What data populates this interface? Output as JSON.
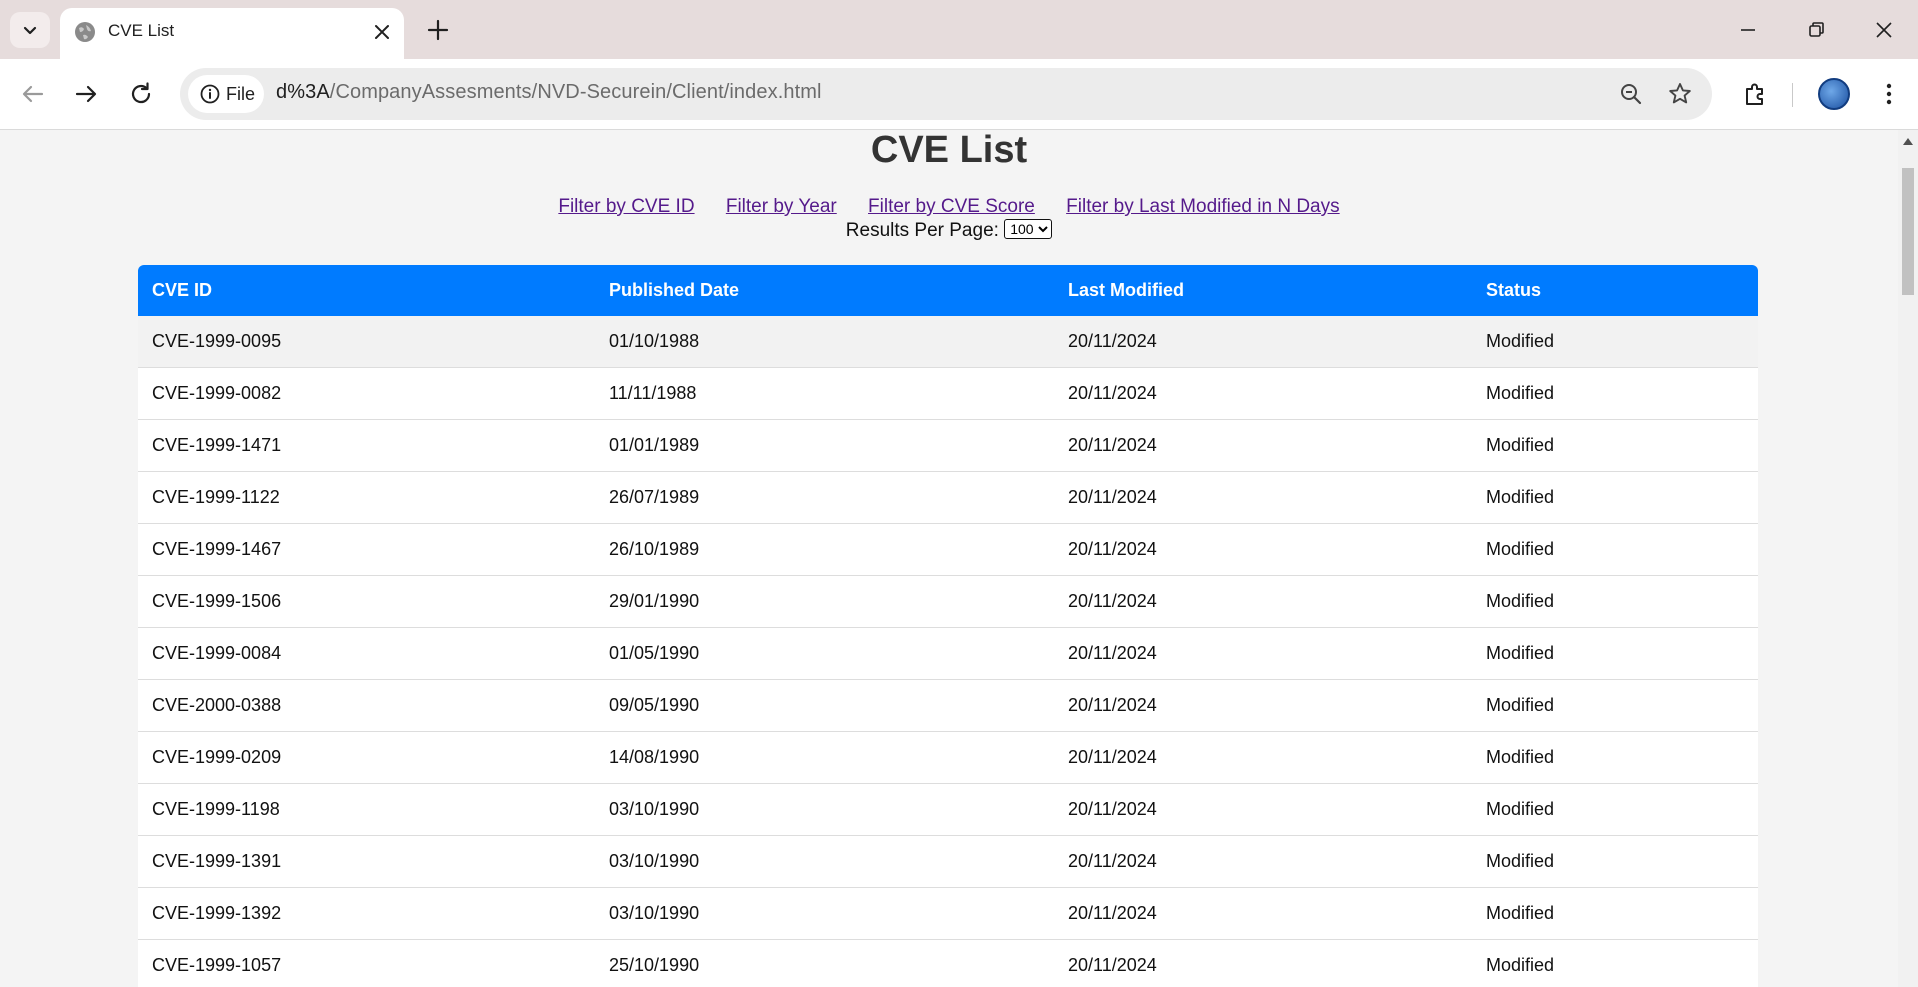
{
  "browser": {
    "tab_title": "CVE List",
    "site_chip": "File",
    "url_host": "d%3A",
    "url_path": "/CompanyAssesments/NVD-Securein/Client/index.html"
  },
  "page": {
    "title": "CVE List",
    "filters": [
      "Filter by CVE ID",
      "Filter by Year",
      "Filter by CVE Score",
      "Filter by Last Modified in N Days"
    ],
    "results_per_page_label": "Results Per Page:",
    "results_per_page_value": "100"
  },
  "table": {
    "headers": [
      "CVE ID",
      "Published Date",
      "Last Modified",
      "Status"
    ],
    "rows": [
      [
        "CVE-1999-0095",
        "01/10/1988",
        "20/11/2024",
        "Modified"
      ],
      [
        "CVE-1999-0082",
        "11/11/1988",
        "20/11/2024",
        "Modified"
      ],
      [
        "CVE-1999-1471",
        "01/01/1989",
        "20/11/2024",
        "Modified"
      ],
      [
        "CVE-1999-1122",
        "26/07/1989",
        "20/11/2024",
        "Modified"
      ],
      [
        "CVE-1999-1467",
        "26/10/1989",
        "20/11/2024",
        "Modified"
      ],
      [
        "CVE-1999-1506",
        "29/01/1990",
        "20/11/2024",
        "Modified"
      ],
      [
        "CVE-1999-0084",
        "01/05/1990",
        "20/11/2024",
        "Modified"
      ],
      [
        "CVE-2000-0388",
        "09/05/1990",
        "20/11/2024",
        "Modified"
      ],
      [
        "CVE-1999-0209",
        "14/08/1990",
        "20/11/2024",
        "Modified"
      ],
      [
        "CVE-1999-1198",
        "03/10/1990",
        "20/11/2024",
        "Modified"
      ],
      [
        "CVE-1999-1391",
        "03/10/1990",
        "20/11/2024",
        "Modified"
      ],
      [
        "CVE-1999-1392",
        "03/10/1990",
        "20/11/2024",
        "Modified"
      ],
      [
        "CVE-1999-1057",
        "25/10/1990",
        "20/11/2024",
        "Modified"
      ]
    ]
  },
  "colors": {
    "header_bg": "#007bff",
    "link": "#551a8b",
    "page_bg": "#f4f4f4"
  }
}
